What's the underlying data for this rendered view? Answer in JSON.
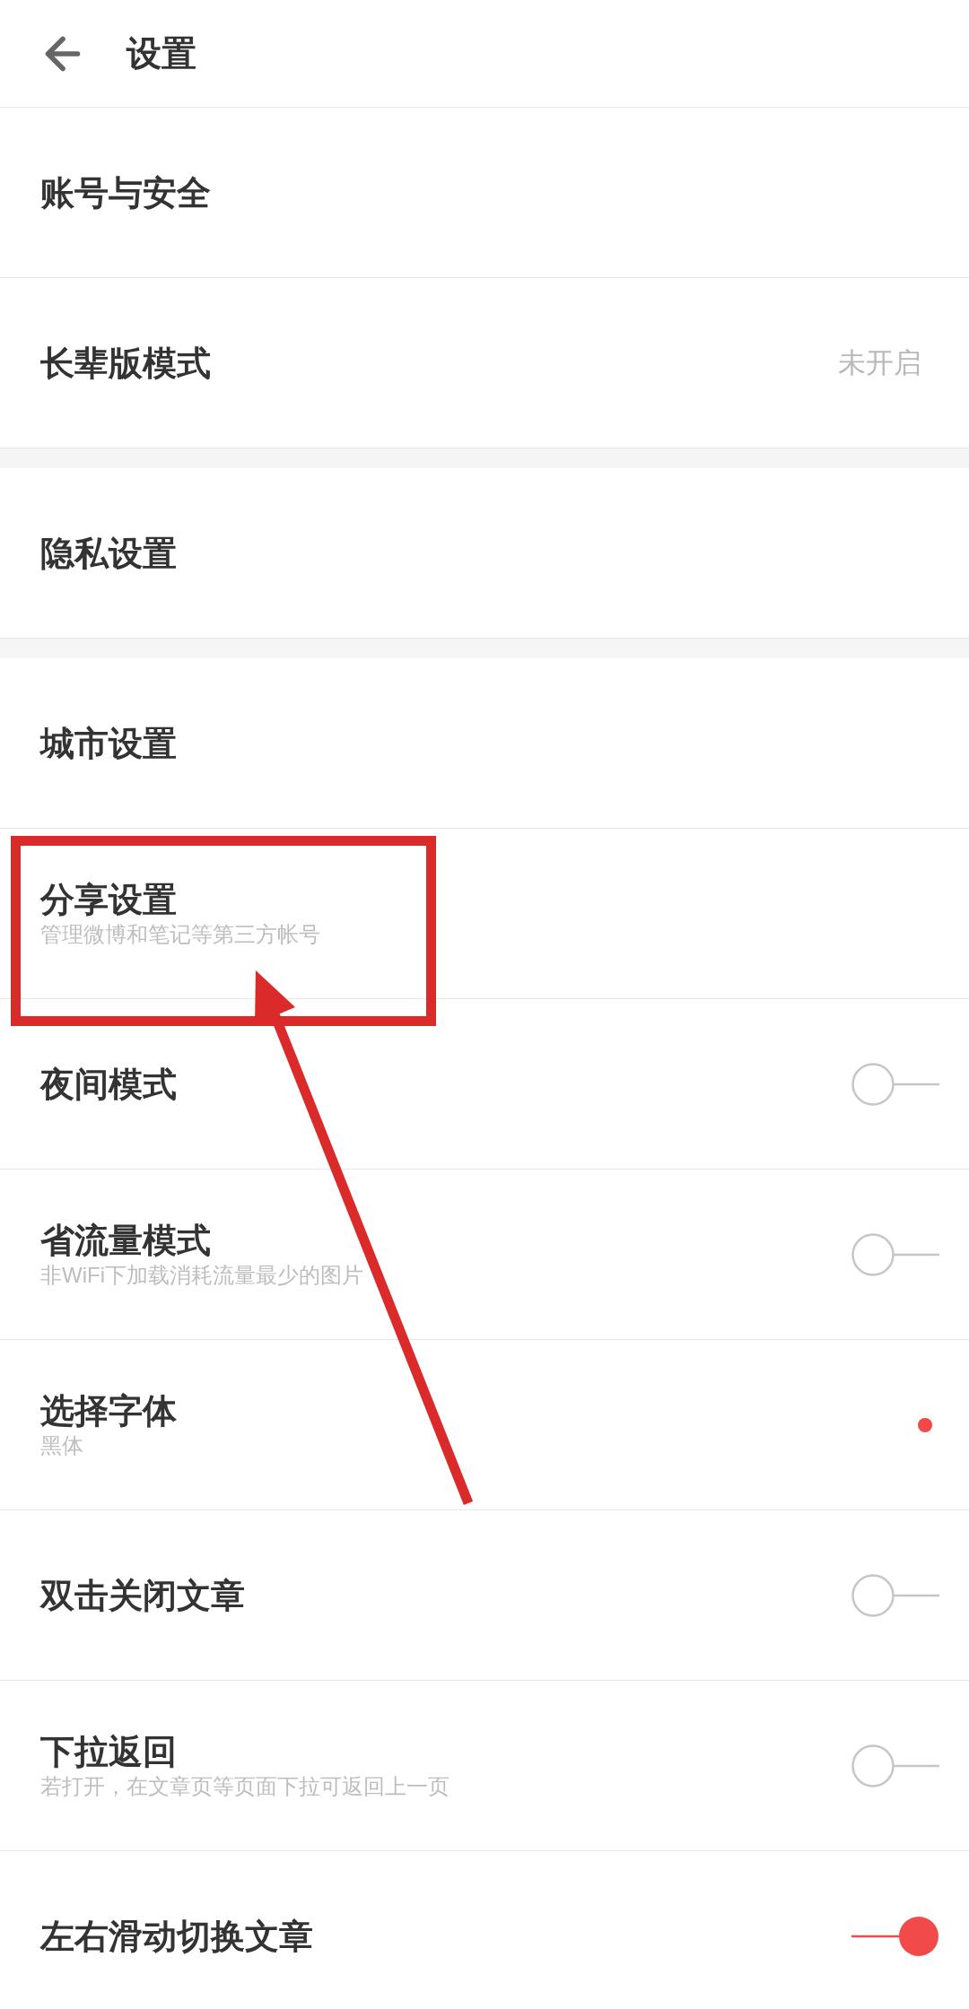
{
  "header": {
    "title": "设置"
  },
  "sections": [
    {
      "items": [
        {
          "kind": "plain",
          "title": "账号与安全"
        },
        {
          "kind": "value",
          "title": "长辈版模式",
          "value": "未开启"
        }
      ]
    },
    {
      "items": [
        {
          "kind": "plain",
          "title": "隐私设置"
        }
      ]
    },
    {
      "items": [
        {
          "kind": "plain",
          "title": "城市设置"
        },
        {
          "kind": "plain",
          "title": "分享设置",
          "subtitle": "管理微博和笔记等第三方帐号"
        },
        {
          "kind": "toggle",
          "title": "夜间模式",
          "on": false
        },
        {
          "kind": "toggle",
          "title": "省流量模式",
          "subtitle": "非WiFi下加载消耗流量最少的图片",
          "on": false
        },
        {
          "kind": "dot",
          "title": "选择字体",
          "subtitle": "黑体"
        },
        {
          "kind": "toggle",
          "title": "双击关闭文章",
          "on": false
        },
        {
          "kind": "toggle",
          "title": "下拉返回",
          "subtitle": "若打开，在文章页等页面下拉可返回上一页",
          "on": false
        },
        {
          "kind": "toggle",
          "title": "左右滑动切换文章",
          "on": true
        }
      ]
    }
  ],
  "annotation": {
    "highlight_box": true,
    "arrow": true
  }
}
